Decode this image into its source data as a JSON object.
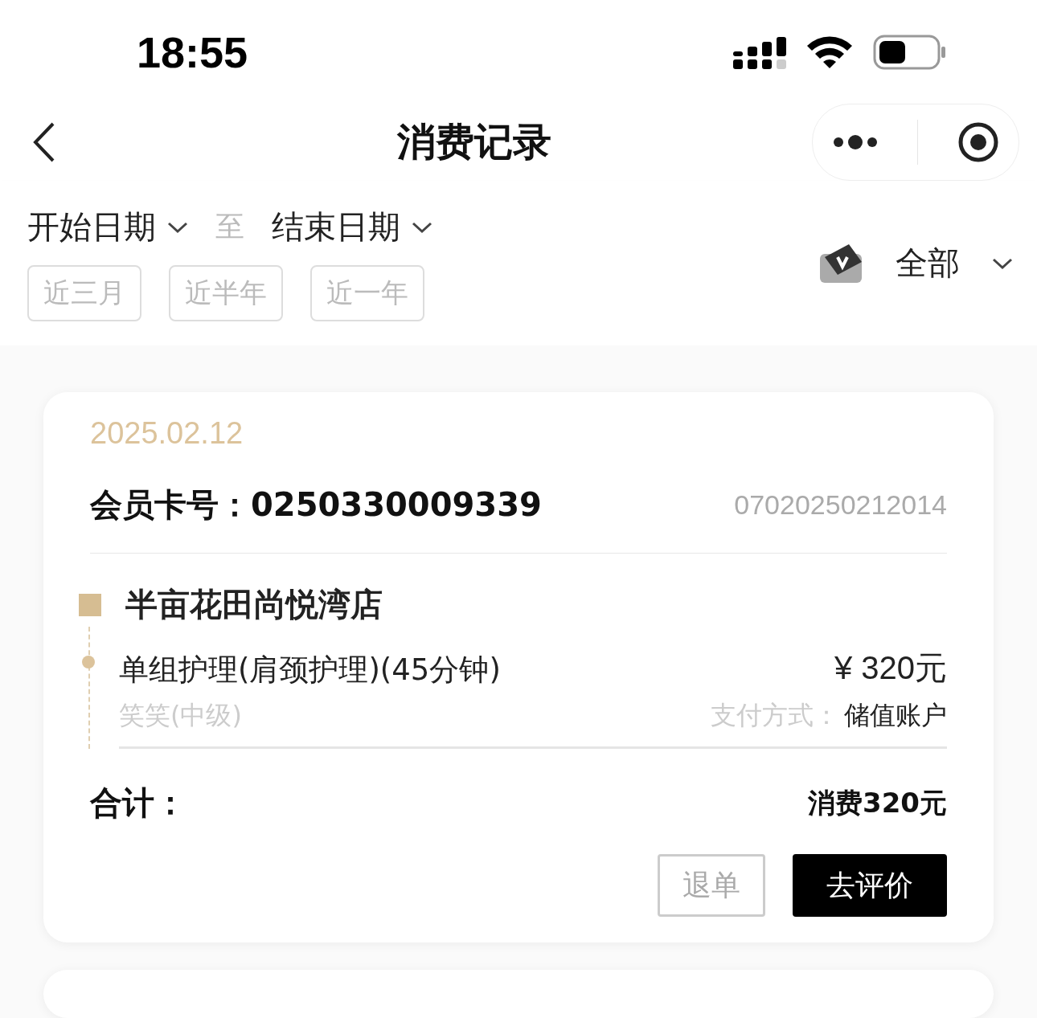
{
  "status_bar": {
    "time": "18:55"
  },
  "nav": {
    "title": "消费记录"
  },
  "filter": {
    "start_date": "开始日期",
    "separator": "至",
    "end_date": "结束日期",
    "quick_ranges": [
      "近三月",
      "近半年",
      "近一年"
    ],
    "category": "全部"
  },
  "records": [
    {
      "date": "2025.02.12",
      "member_label": "会员卡号：",
      "member_no": "0250330009339",
      "order_no": "07020250212014",
      "store": "半亩花田尚悦湾店",
      "items": [
        {
          "name": "单组护理(肩颈护理)(45分钟)",
          "staff": "笑笑(中级)",
          "price": "¥ 320元",
          "payment_label": "支付方式：",
          "payment": "储值账户"
        }
      ],
      "total_label": "合计：",
      "total": "消费320元",
      "actions": [
        {
          "label": "退单",
          "kind": "outline"
        },
        {
          "label": "去评价",
          "kind": "solid"
        }
      ]
    }
  ],
  "more_cards": true
}
